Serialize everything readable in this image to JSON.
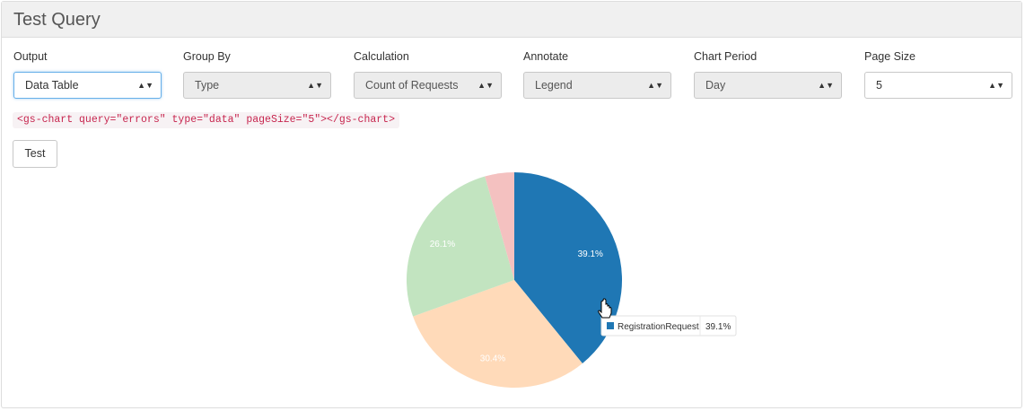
{
  "header": {
    "title": "Test Query"
  },
  "form": {
    "fields": [
      {
        "label": "Output",
        "value": "Data Table"
      },
      {
        "label": "Group By",
        "value": "Type"
      },
      {
        "label": "Calculation",
        "value": "Count of Requests"
      },
      {
        "label": "Annotate",
        "value": "Legend"
      },
      {
        "label": "Chart Period",
        "value": "Day"
      },
      {
        "label": "Page Size",
        "value": "5"
      }
    ]
  },
  "code_snippet": "<gs-chart query=\"errors\" type=\"data\" pageSize=\"5\"></gs-chart>",
  "test_button": "Test",
  "colors": {
    "blue": "#1f77b4",
    "orange": "#ffdab9",
    "green": "#c2e4c0",
    "pink": "#f4c1c0"
  },
  "chart_data": {
    "type": "pie",
    "slices": [
      {
        "label": "39.1%",
        "value": 39.1,
        "color": "#1f77b4"
      },
      {
        "label": "30.4%",
        "value": 30.4,
        "color": "#ffdab9"
      },
      {
        "label": "26.1%",
        "value": 26.1,
        "color": "#c2e4c0"
      },
      {
        "label": "",
        "value": 4.4,
        "color": "#f4c1c0"
      }
    ],
    "tooltip": {
      "name": "RegistrationRequest",
      "value": "39.1%"
    }
  }
}
